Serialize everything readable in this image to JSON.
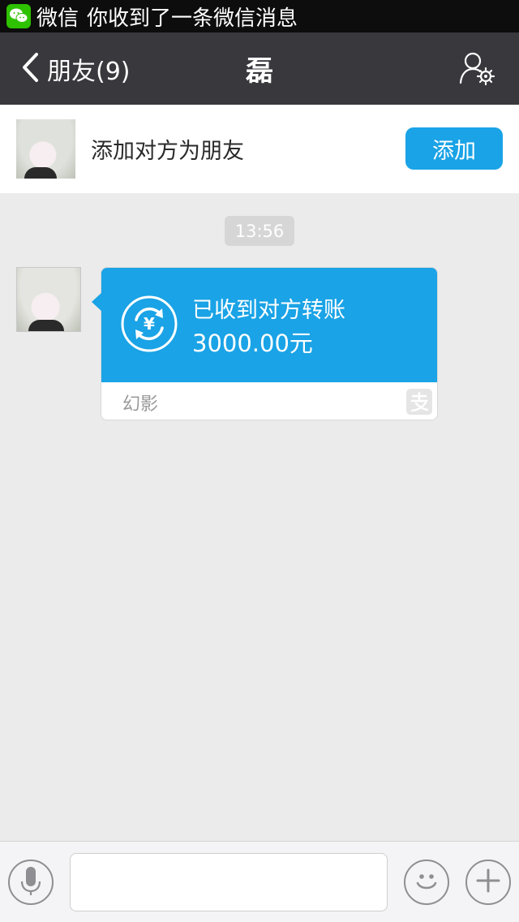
{
  "notification": {
    "app_name": "微信",
    "message": "你收到了一条微信消息",
    "icon": "wechat-logo-icon"
  },
  "titlebar": {
    "back_label": "朋友(9)",
    "title": "磊",
    "back_icon": "chevron-left-icon",
    "profile_icon": "contact-settings-icon"
  },
  "add_friend": {
    "prompt": "添加对方为朋友",
    "button_label": "添加"
  },
  "chat": {
    "timestamp": "13:56",
    "messages": [
      {
        "type": "transfer",
        "status": "已收到对方转账",
        "amount": "3000.00元",
        "source": "幻影",
        "icon": "yuan-transfer-icon",
        "source_icon": "alipay-icon"
      }
    ]
  },
  "input_bar": {
    "voice_icon": "microphone-icon",
    "text_value": "",
    "emoji_icon": "smiley-icon",
    "more_icon": "plus-icon"
  },
  "colors": {
    "accent": "#1aa3e6",
    "titlebar": "#38383d",
    "chat_background": "#ebebeb",
    "wechat_green": "#2dc100"
  }
}
